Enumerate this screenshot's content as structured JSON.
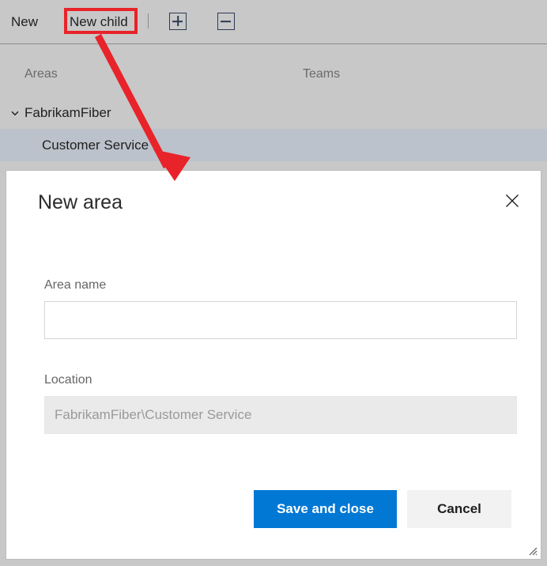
{
  "toolbar": {
    "new_label": "New",
    "new_child_label": "New child",
    "expand_all_icon": "plus-box-icon",
    "collapse_all_icon": "minus-box-icon",
    "separator": "|"
  },
  "columns": {
    "areas_label": "Areas",
    "teams_label": "Teams"
  },
  "tree": {
    "items": [
      {
        "label": "FabrikamFiber",
        "expanded": true,
        "selected": false,
        "indent": 0
      },
      {
        "label": "Customer Service",
        "expanded": false,
        "selected": true,
        "indent": 1
      }
    ]
  },
  "dialog": {
    "title": "New area",
    "close_icon": "close-icon",
    "resize_grip_icon": "resize-grip-icon",
    "fields": {
      "area_name": {
        "label": "Area name",
        "value": "",
        "placeholder": ""
      },
      "location": {
        "label": "Location",
        "value": "FabrikamFiber\\Customer Service",
        "readonly": true
      }
    },
    "buttons": {
      "save_label": "Save and close",
      "cancel_label": "Cancel"
    }
  },
  "annotation": {
    "highlight_target": "New child",
    "arrow_color": "#e8232a",
    "box_color": "#e8232a"
  },
  "colors": {
    "accent_blue": "#0078d4",
    "page_background": "#c8c8c8",
    "selected_row": "#bcc2cb",
    "dialog_background": "#ffffff",
    "annotation_red": "#e8232a",
    "readonly_field": "#eaeaea"
  }
}
